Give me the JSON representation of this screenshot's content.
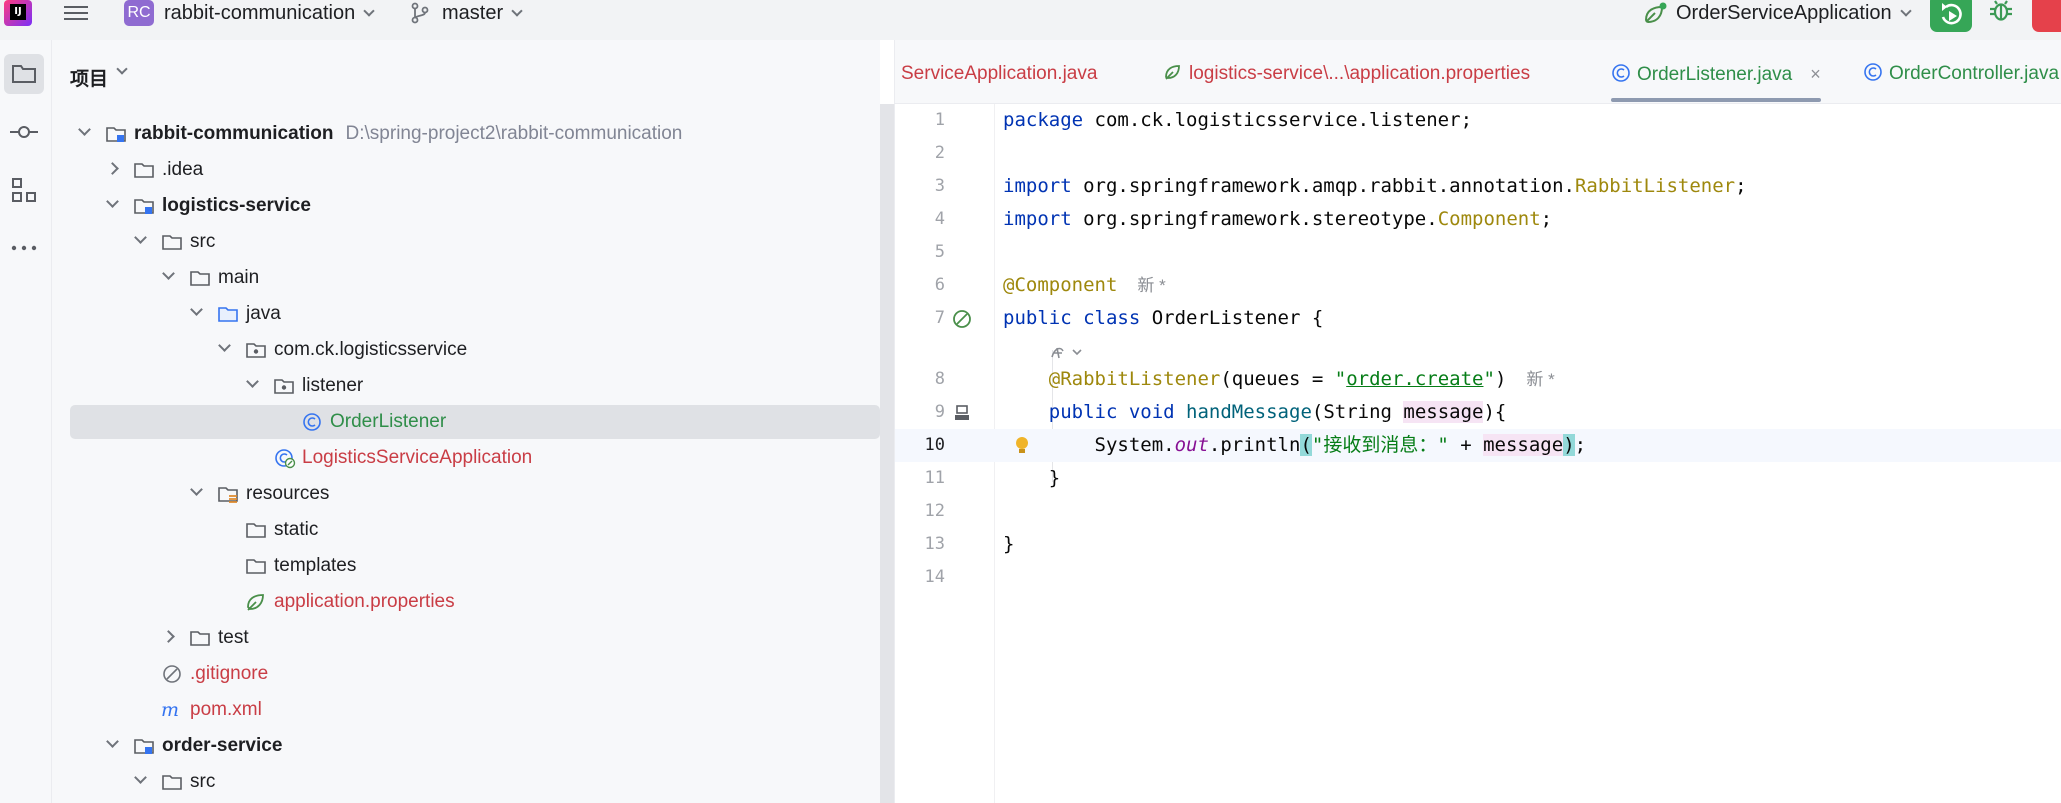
{
  "topbar": {
    "app_icon_text": "IJ",
    "project_badge": "RC",
    "project_name": "rabbit-communication",
    "branch": "master",
    "run_config": "OrderServiceApplication"
  },
  "project_panel": {
    "title": "项目",
    "tree": [
      {
        "label": "rabbit-communication",
        "path": "D:\\spring-project2\\rabbit-communication",
        "depth": 0,
        "arrow": "down",
        "icon": "module-folder",
        "style": "bold"
      },
      {
        "label": ".idea",
        "depth": 1,
        "arrow": "right",
        "icon": "folder",
        "style": "normal"
      },
      {
        "label": "logistics-service",
        "depth": 1,
        "arrow": "down",
        "icon": "module-folder",
        "style": "bold"
      },
      {
        "label": "src",
        "depth": 2,
        "arrow": "down",
        "icon": "folder",
        "style": "normal"
      },
      {
        "label": "main",
        "depth": 3,
        "arrow": "down",
        "icon": "folder",
        "style": "normal"
      },
      {
        "label": "java",
        "depth": 4,
        "arrow": "down",
        "icon": "source-folder",
        "style": "normal"
      },
      {
        "label": "com.ck.logisticsservice",
        "depth": 5,
        "arrow": "down",
        "icon": "package",
        "style": "normal"
      },
      {
        "label": "listener",
        "depth": 6,
        "arrow": "down",
        "icon": "package",
        "style": "normal"
      },
      {
        "label": "OrderListener",
        "depth": 7,
        "arrow": "none",
        "icon": "class",
        "style": "green",
        "selected": true
      },
      {
        "label": "LogisticsServiceApplication",
        "depth": 6,
        "arrow": "none",
        "icon": "spring-class",
        "style": "red"
      },
      {
        "label": "resources",
        "depth": 4,
        "arrow": "down",
        "icon": "resources-folder",
        "style": "normal"
      },
      {
        "label": "static",
        "depth": 5,
        "arrow": "none",
        "icon": "folder",
        "style": "normal"
      },
      {
        "label": "templates",
        "depth": 5,
        "arrow": "none",
        "icon": "folder",
        "style": "normal"
      },
      {
        "label": "application.properties",
        "depth": 5,
        "arrow": "none",
        "icon": "spring-properties",
        "style": "red"
      },
      {
        "label": "test",
        "depth": 3,
        "arrow": "right",
        "icon": "folder",
        "style": "normal"
      },
      {
        "label": ".gitignore",
        "depth": 2,
        "arrow": "none",
        "icon": "gitignore",
        "style": "red"
      },
      {
        "label": "pom.xml",
        "depth": 2,
        "arrow": "none",
        "icon": "maven",
        "style": "red"
      },
      {
        "label": "order-service",
        "depth": 1,
        "arrow": "down",
        "icon": "module-folder",
        "style": "bold"
      },
      {
        "label": "src",
        "depth": 2,
        "arrow": "down",
        "icon": "folder",
        "style": "normal"
      }
    ]
  },
  "editor": {
    "tabs": [
      {
        "label": "ServiceApplication.java",
        "icon": "none",
        "style": "red"
      },
      {
        "label": "logistics-service\\...\\application.properties",
        "icon": "spring-leaf-icon",
        "style": "red"
      },
      {
        "label": "OrderListener.java",
        "icon": "class-icon",
        "style": "active",
        "close": "×"
      },
      {
        "label": "OrderController.java",
        "icon": "class-icon",
        "style": "normal"
      }
    ],
    "lines": [
      {
        "n": "1"
      },
      {
        "n": "2"
      },
      {
        "n": "3"
      },
      {
        "n": "4"
      },
      {
        "n": "5"
      },
      {
        "n": "6"
      },
      {
        "n": "7"
      },
      {
        "n": "8"
      },
      {
        "n": "9"
      },
      {
        "n": "10"
      },
      {
        "n": "11"
      },
      {
        "n": "12"
      },
      {
        "n": "13"
      },
      {
        "n": "14"
      }
    ],
    "code": {
      "l1_kw": "package",
      "l1_rest": " com.ck.logisticsservice.listener;",
      "l3_kw": "import",
      "l3_pkg": " org.springframework.amqp.rabbit.annotation.",
      "l3_cls": "RabbitListener",
      "l3_end": ";",
      "l4_kw": "import",
      "l4_pkg": " org.springframework.stereotype.",
      "l4_cls": "Component",
      "l4_end": ";",
      "l6_ann": "@Component",
      "l6_hint": "新 *",
      "l7_kw": "public class",
      "l7_rest": " OrderListener {",
      "l8_ann": "@RabbitListener",
      "l8_open": "(queues = ",
      "l8_q1": "\"",
      "l8_str": "order.create",
      "l8_q2": "\"",
      "l8_close": ")",
      "l8_hint": "新 *",
      "l9_kw": "public void",
      "l9_name": " handMessage",
      "l9_open": "(String ",
      "l9_param": "message",
      "l9_close": "){",
      "l10_sys": "System.",
      "l10_out": "out",
      "l10_call": ".println",
      "l10_lp": "(",
      "l10_str": "\"接收到消息：\"",
      "l10_plus": " + ",
      "l10_arg": "message",
      "l10_rp": ")",
      "l10_end": ";",
      "l11_brace": "}",
      "l13_brace": "}"
    }
  },
  "colors": {
    "accent_green": "#2f8e49",
    "error_red": "#c93d45",
    "keyword_blue": "#0033b3",
    "annotation_olive": "#9e880d",
    "run_green": "#36a657"
  }
}
